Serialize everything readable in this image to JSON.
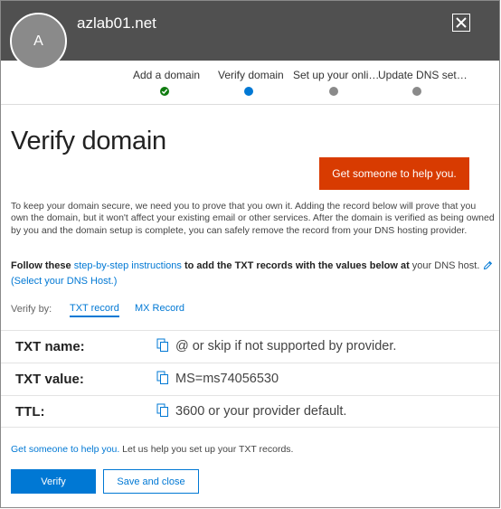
{
  "header": {
    "avatar_initial": "A",
    "domain": "azlab01.net",
    "close_icon": "close-icon"
  },
  "steps": [
    {
      "label": "Add a domain",
      "status": "done"
    },
    {
      "label": "Verify domain",
      "status": "current"
    },
    {
      "label": "Set up your onli…",
      "status": "todo"
    },
    {
      "label": "Update DNS set…",
      "status": "todo"
    }
  ],
  "colors": {
    "header_bg": "#505050",
    "accent": "#0078d4",
    "help_button": "#d83b01",
    "step_done": "#107c10",
    "step_todo": "#8a8a8a"
  },
  "main": {
    "title": "Verify domain",
    "help_button_label": "Get someone to help you.",
    "intro": "To keep your domain secure, we need you to prove that you own it. Adding the record below will prove that you own the domain, but it won't affect your existing email or other services. After the domain is verified as being owned by you and the domain setup is complete, you can safely remove the record from your DNS hosting provider.",
    "follow_prefix": "Follow these",
    "follow_link": "step-by-step instructions",
    "follow_middle": "to add the TXT records with the values below at",
    "follow_suffix": "your DNS host.",
    "dns_host_link": "(Select your DNS Host.)",
    "verify_by_label": "Verify by:",
    "tabs": [
      {
        "label": "TXT record",
        "active": true
      },
      {
        "label": "MX Record",
        "active": false
      }
    ]
  },
  "records": [
    {
      "label": "TXT name:",
      "value": "@ or skip if not supported by provider."
    },
    {
      "label": "TXT value:",
      "value": "MS=ms74056530"
    },
    {
      "label": "TTL:",
      "value": "3600 or your provider default."
    }
  ],
  "footer": {
    "help_link": "Get someone to help you.",
    "help_text": "Let us help you set up your TXT records.",
    "verify_button": "Verify",
    "save_button": "Save and close"
  }
}
